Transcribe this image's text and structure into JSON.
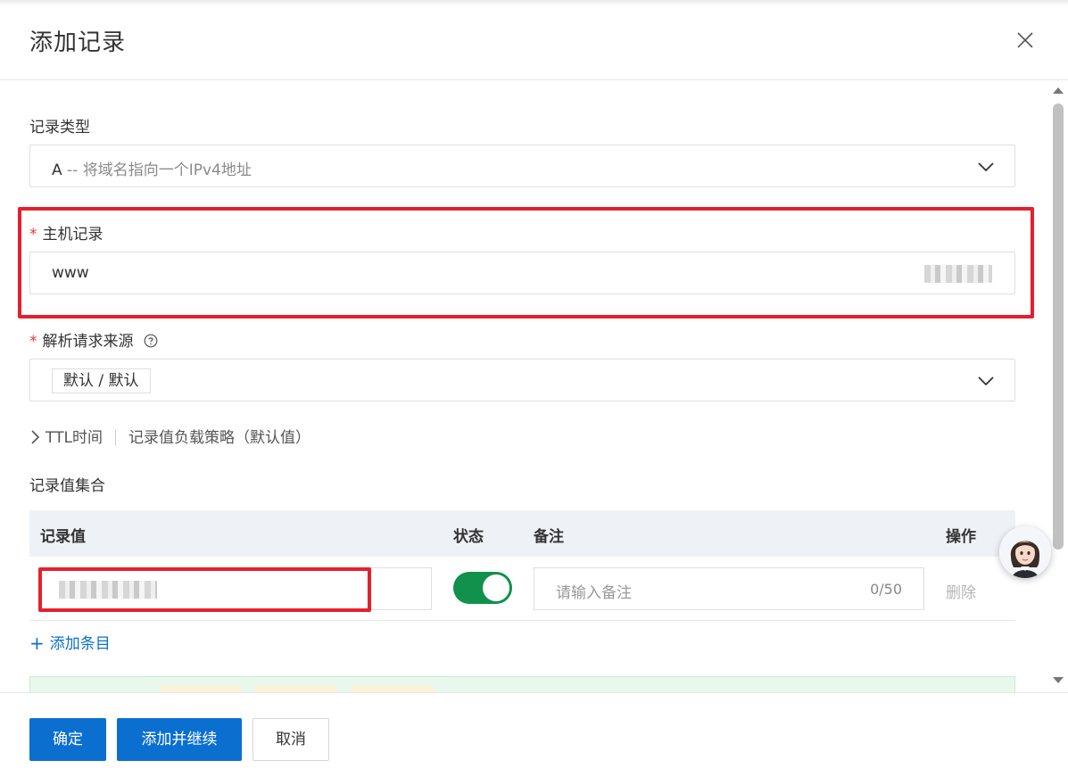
{
  "dialog": {
    "title": "添加记录"
  },
  "record_type": {
    "label": "记录类型",
    "value_letter": "A",
    "value_desc": "-- 将域名指向一个IPv4地址"
  },
  "host_record": {
    "required_mark": "*",
    "label": "主机记录",
    "value": "www"
  },
  "resolve_source": {
    "required_mark": "*",
    "label": "解析请求来源",
    "tag": "默认 / 默认"
  },
  "advanced": {
    "ttl": "TTL时间",
    "strategy": "记录值负载策略（默认值）"
  },
  "record_values": {
    "section_label": "记录值集合",
    "columns": [
      "记录值",
      "状态",
      "备注",
      "操作"
    ],
    "row": {
      "status_on": true,
      "remark_placeholder": "请输入备注",
      "remark_counter": "0/50",
      "delete_label": "删除"
    },
    "add_entry_label": "添加条目"
  },
  "footer": {
    "confirm": "确定",
    "add_continue": "添加并继续",
    "cancel": "取消"
  },
  "colors": {
    "primary": "#0b6fd0",
    "toggle_on": "#11914b",
    "highlight": "#e5202e",
    "required": "#e4393c"
  }
}
